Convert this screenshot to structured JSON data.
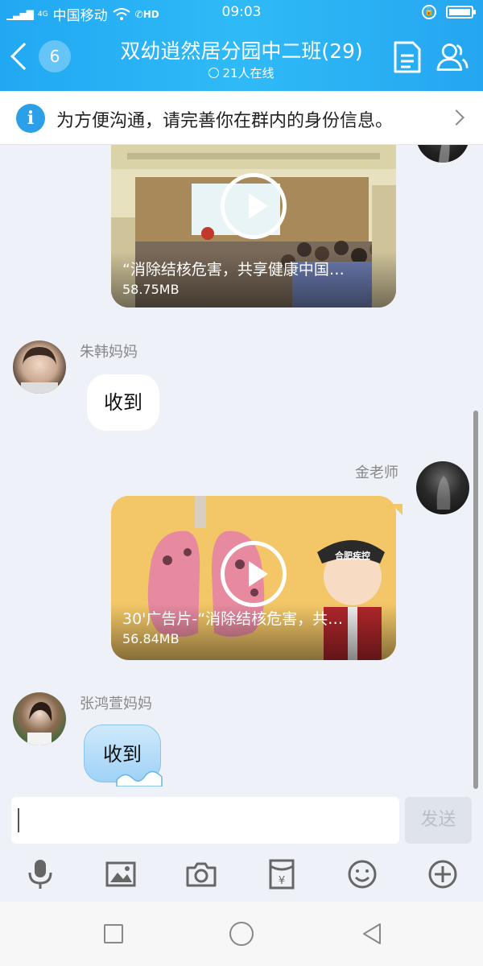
{
  "status": {
    "carrier": "中国移动",
    "network": "4G",
    "hd": "HD",
    "time": "09:03"
  },
  "header": {
    "back_count": "6",
    "title": "双幼逍然居分园中二班(29)",
    "online": "21人在线"
  },
  "banner": {
    "text": "为方便沟通，请完善你在群内的身份信息。"
  },
  "messages": [
    {
      "type": "video",
      "side": "right",
      "title": "“消除结核危害，共享健康中国…",
      "size": "58.75MB"
    },
    {
      "type": "text",
      "side": "left",
      "sender": "朱韩妈妈",
      "text": "收到"
    },
    {
      "type": "video",
      "side": "right",
      "sender": "金老师",
      "title": "30'广告片-“消除结核危害，共…",
      "size": "56.84MB",
      "cap_text": "合肥疾控"
    },
    {
      "type": "text",
      "side": "left",
      "sender": "张鸿萱妈妈",
      "text": "收到"
    }
  ],
  "input": {
    "value": "",
    "send_label": "发送"
  },
  "toolbar": [
    "microphone-icon",
    "image-icon",
    "camera-icon",
    "red-packet-icon",
    "emoji-icon",
    "plus-icon"
  ],
  "colors": {
    "header": "#2bb2f5",
    "chat_bg": "#eef2f8",
    "video2_bg": "#f3c767"
  }
}
